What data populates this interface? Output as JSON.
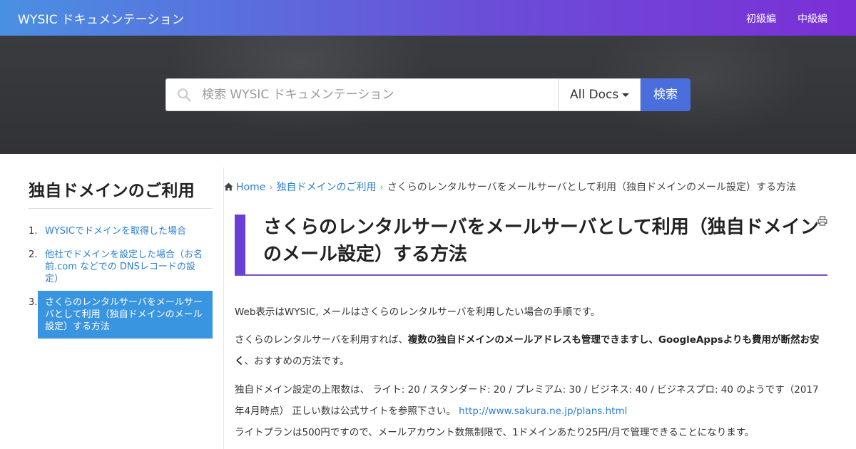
{
  "header": {
    "brand": "WYSIC ドキュメンテーション",
    "nav": [
      "初級編",
      "中級編"
    ]
  },
  "search": {
    "placeholder": "検索 WYSIC ドキュメンテーション",
    "scope": "All Docs",
    "button": "検索"
  },
  "sidebar": {
    "title": "独自ドメインのご利用",
    "items": [
      {
        "num": "1.",
        "label": "WYSICでドメインを取得した場合"
      },
      {
        "num": "2.",
        "label": "他社でドメインを設定した場合（お名前.com などでの DNSレコードの設定）"
      },
      {
        "num": "3.",
        "label": "さくらのレンタルサーバをメールサーバとして利用（独自ドメインのメール設定）する方法"
      }
    ]
  },
  "breadcrumb": {
    "home": "Home",
    "section": "独自ドメインのご利用",
    "current": "さくらのレンタルサーバをメールサーバとして利用（独自ドメインのメール設定）する方法"
  },
  "article": {
    "title": "さくらのレンタルサーバをメールサーバとして利用（独自ドメインのメール設定）する方法",
    "p1": "Web表示はWYSIC, メールはさくらのレンタルサーバを利用したい場合の手順です。",
    "p2_a": "さくらのレンタルサーバを利用すれば、",
    "p2_bold": "複数の独自ドメインのメールアドレスも管理できますし、GoogleAppsよりも費用が断然お安く",
    "p2_b": "、おすすめの方法です。",
    "p3": "独自ドメイン設定の上限数は、 ライト: 20 / スタンダード: 20 / プレミアム: 30 / ビジネス: 40 / ビジネスプロ: 40 のようです（2017年4月時点） 正しい数は公式サイトを参照下さい。 ",
    "p3_link": "http://www.sakura.ne.jp/plans.html",
    "p4": "ライトプランは500円ですので、メールアカウント数無制限で、1ドメインあたり25円/月で管理できることになります。"
  },
  "colors": {
    "header_gradient_start": "#4a90e2",
    "header_gradient_end": "#7b2fd6",
    "accent_purple": "#6a3fd6",
    "link_blue": "#2a7fcf",
    "active_item_bg": "#3a95e0",
    "search_button_bg": "#4a6fdc"
  },
  "icons": {
    "search": "search-icon",
    "home": "home-icon",
    "print": "print-icon",
    "dropdown": "caret-down-icon"
  }
}
